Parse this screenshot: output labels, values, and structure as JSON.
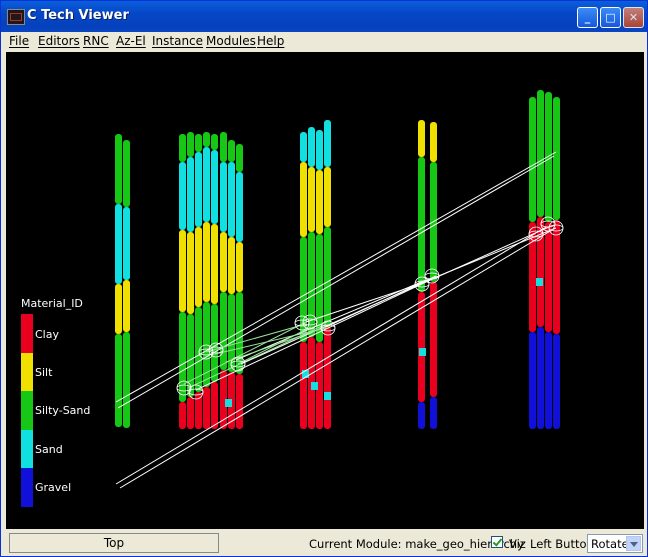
{
  "window": {
    "title": "C Tech Viewer",
    "minimize_glyph": "_",
    "maximize_glyph": "□",
    "close_glyph": "✕"
  },
  "menu": {
    "items": [
      "File",
      "Editors",
      "RNC",
      "Az-El",
      "Instance",
      "Modules",
      "Help"
    ]
  },
  "legend": {
    "title": "Material_ID",
    "entries": [
      {
        "label": "Clay",
        "color": "#e8001e"
      },
      {
        "label": "Silt",
        "color": "#f0e000"
      },
      {
        "label": "Silty-Sand",
        "color": "#16c716"
      },
      {
        "label": "Sand",
        "color": "#12e0e0"
      },
      {
        "label": "Gravel",
        "color": "#1010d8"
      }
    ]
  },
  "statusbar": {
    "view_button": "Top",
    "current_module": "Current Module: make_geo_hierarchy",
    "viz_checked": true,
    "viz_label": "Viz",
    "left_button_label": "Left Button",
    "left_button_mode": "Rotate"
  },
  "colors": {
    "clay": "#e8001e",
    "silt": "#f0e000",
    "silty_sand": "#16c716",
    "sand": "#12e0e0",
    "gravel": "#1010d8",
    "background": "#000000"
  }
}
